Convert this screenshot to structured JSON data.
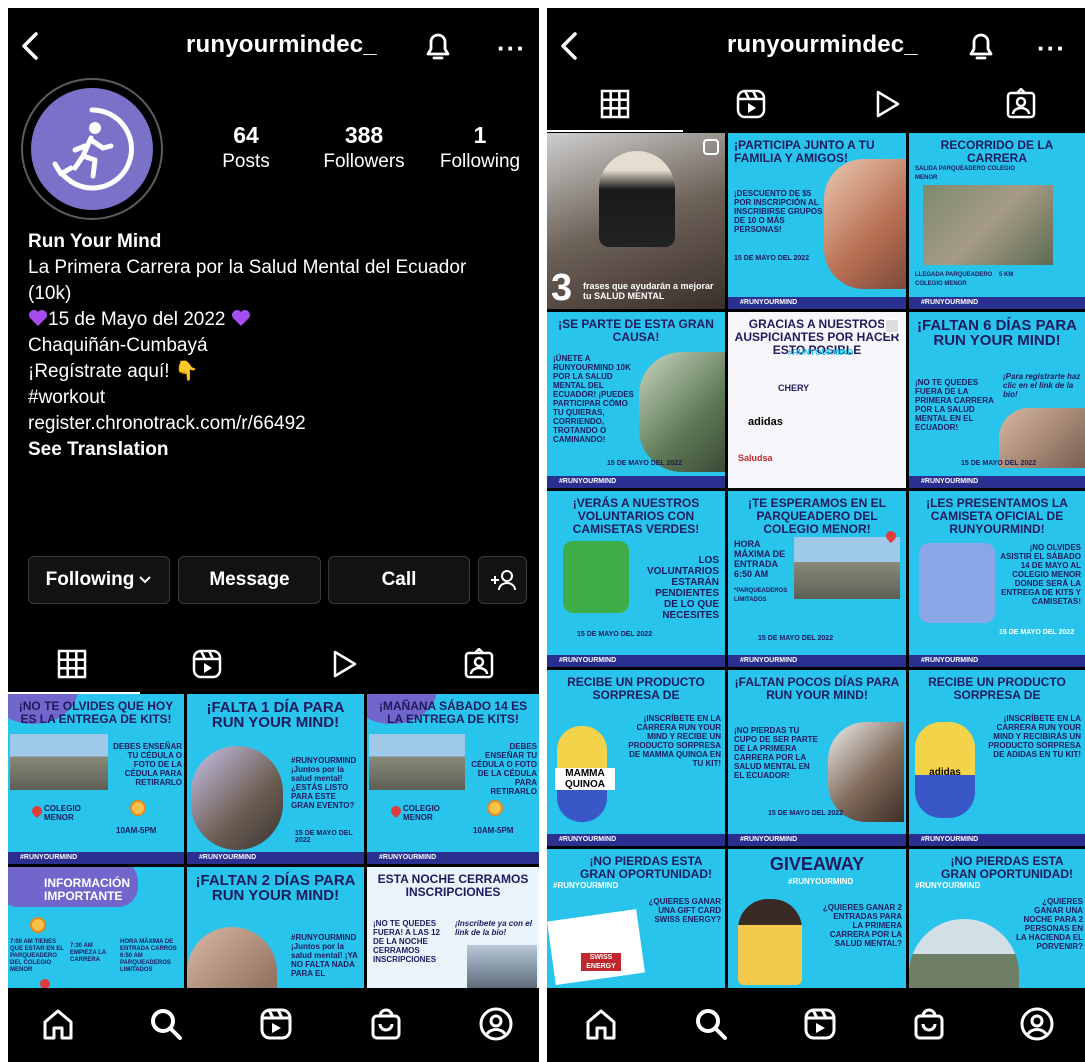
{
  "colors": {
    "background": "#000000",
    "accent_purple": "#7066cc",
    "tile_cyan": "#29c4ec",
    "navy": "#1d1b5e"
  },
  "profile": {
    "username": "runyourmindec_",
    "stats": [
      {
        "num": "64",
        "label": "Posts"
      },
      {
        "num": "388",
        "label": "Followers"
      },
      {
        "num": "1",
        "label": "Following"
      }
    ],
    "name": "Run Your Mind",
    "bio_line1": "La Primera Carrera por la Salud Mental del Ecuador",
    "bio_line2": "(10k)",
    "bio_date": "15 de Mayo del 2022",
    "bio_place": "Chaquiñán-Cumbayá",
    "bio_register": "¡Regístrate aquí! 👇",
    "bio_hashtag": "#workout",
    "bio_link": "register.chronotrack.com/r/66492",
    "see_translation": "See Translation"
  },
  "buttons": {
    "following": "Following",
    "message": "Message",
    "call": "Call"
  },
  "icons": [
    "back-icon",
    "bell-icon",
    "more-icon",
    "grid-icon",
    "reels-icon",
    "play-icon",
    "tagged-icon",
    "home-icon",
    "search-icon",
    "reels-nav-icon",
    "shop-icon",
    "profile-icon",
    "add-person-icon"
  ],
  "left_posts": [
    {
      "head": "¡NO TE OLVIDES QUE HOY ES LA ENTREGA DE KITS!",
      "body": "DEBES ENSEÑAR TU CÉDULA O FOTO DE LA CÉDULA PARA RETIRARLO",
      "place": "COLEGIO MENOR",
      "time": "10AM-5PM",
      "foot": "#RUNYOURMIND"
    },
    {
      "head": "¡FALTA 1 DÍA PARA RUN YOUR MIND!",
      "body": "#RUNYOURMIND ¡Juntos por la salud mental! ¿ESTÁS LISTO PARA ESTE GRAN EVENTO?",
      "date": "15 DE MAYO DEL 2022",
      "foot": "#RUNYOURMIND"
    },
    {
      "head": "¡MAÑANA SÁBADO 14 ES LA ENTREGA DE KITS!",
      "body": "DEBES ENSEÑAR TU CÉDULA O FOTO DE LA CÉDULA PARA RETIRARLO",
      "place": "COLEGIO MENOR",
      "time": "10AM-5PM",
      "foot": "#RUNYOURMIND"
    },
    {
      "head": "INFORMACIÓN IMPORTANTE",
      "body": "7:00 AM TIENES QUE ESTAR EN EL PARQUEADERO DEL COLEGIO MENOR",
      "body2": "7:30 AM EMPIEZA LA CARRERA",
      "body3": "HORA MÁXIMA DE ENTRADA CARROS 6:50 AM PARQUEADEROS LIMITADOS"
    },
    {
      "head": "¡FALTAN 2 DÍAS PARA RUN YOUR MIND!",
      "body": "#RUNYOURMIND ¡Juntos por la salud mental! ¡YA NO FALTA NADA PARA EL"
    },
    {
      "head": "ESTA NOCHE CERRAMOS INSCRIPCIONES",
      "body": "¡NO TE QUEDES FUERA! A LAS 12 DE LA NOCHE CERRAMOS INSCRIPCIONES",
      "body2": "¡Inscríbete ya con el link de la bio!"
    }
  ],
  "right_posts": [
    {
      "head": "",
      "body": "frases que ayudarán a mejorar tu SALUD MENTAL",
      "num": "3"
    },
    {
      "head": "¡PARTICIPA JUNTO A TU FAMILIA Y AMIGOS!",
      "body": "¡DESCUENTO DE $5 POR INSCRIPCIÓN AL INSCRIBIRSE GRUPOS DE 10 O MÁS PERSONAS!",
      "date": "15 DE MAYO DEL 2022",
      "foot": "#RUNYOURMIND"
    },
    {
      "head": "RECORRIDO DE LA CARRERA",
      "body": "SALIDA PARQUEADERO COLEGIO MENOR",
      "body2": "LLEGADA PARQUEADERO COLEGIO MENOR",
      "km": "5 KM",
      "foot": "#RUNYOURMIND"
    },
    {
      "head": "¡SE PARTE DE ESTA GRAN CAUSA!",
      "body": "¡ÚNETE A RUNYOURMIND 10K POR LA SALUD MENTAL DEL ECUADOR! ¡PUEDES PARTICIPAR CÓMO TU QUIERAS, CORRIENDO, TROTANDO O CAMINANDO!",
      "date": "15 DE MAYO DEL 2022",
      "foot": "#RUNYOURMIND"
    },
    {
      "head": "GRACIAS A NUESTROS AUSPICIANTES POR HACER ESTO POSIBLE",
      "sub": "#RUNYOURMIND",
      "logos": [
        "CHERY",
        "adidas",
        "Saludsa"
      ]
    },
    {
      "head": "¡FALTAN 6 DÍAS PARA RUN YOUR MIND!",
      "body": "¡NO TE QUEDES FUERA DE LA PRIMERA CARRERA POR LA SALUD MENTAL EN EL ECUADOR!",
      "body2": "¡Para registrarte haz clic en el link de la bio!",
      "date": "15 DE MAYO DEL 2022",
      "foot": "#RUNYOURMIND"
    },
    {
      "head": "¡VERÁS A NUESTROS VOLUNTARIOS CON CAMISETAS VERDES!",
      "body": "LOS VOLUNTARIOS ESTARÁN PENDIENTES DE LO QUE NECESITES",
      "date": "15 DE MAYO DEL 2022",
      "foot": "#RUNYOURMIND"
    },
    {
      "head": "¡TE ESPERAMOS EN EL PARQUEADERO DEL COLEGIO MENOR!",
      "body": "HORA MÁXIMA DE ENTRADA 6:50 AM",
      "body2": "*PARQUEADEROS LIMITADOS",
      "date": "15 DE MAYO DEL 2022",
      "foot": "#RUNYOURMIND"
    },
    {
      "head": "¡LES PRESENTAMOS LA CAMISETA OFICIAL DE RUNYOURMIND!",
      "body": "¡NO OLVIDES ASISTIR EL SÁBADO 14 DE MAYO AL COLEGIO MENOR DONDE SERÁ LA ENTREGA DE KITS Y CAMISETAS!",
      "date": "15 DE MAYO DEL 2022",
      "foot": "#RUNYOURMIND"
    },
    {
      "head": "RECIBE UN PRODUCTO SORPRESA DE",
      "body": "¡INSCRÍBETE EN LA CARRERA RUN YOUR MIND Y RECIBE UN PRODUCTO SORPRESA DE MAMMA QUINOA EN TU KIT!",
      "brand": "MAMMA QUINOA",
      "foot": "#RUNYOURMIND"
    },
    {
      "head": "¡FALTAN POCOS DÍAS PARA RUN YOUR MIND!",
      "body": "¡NO PIERDAS TU CUPO DE SER PARTE DE LA PRIMERA CARRERA POR LA SALUD MENTAL EN EL ECUADOR!",
      "date": "15 DE MAYO DEL 2022",
      "foot": "#RUNYOURMIND"
    },
    {
      "head": "RECIBE UN PRODUCTO SORPRESA DE",
      "body": "¡INSCRÍBETE EN LA CARRERA RUN YOUR MIND Y RECIBIRÁS UN PRODUCTO SORPRESA DE ADIDAS EN TU KIT!",
      "brand": "adidas",
      "foot": "#RUNYOURMIND"
    },
    {
      "head": "¡NO PIERDAS ESTA GRAN OPORTUNIDAD!",
      "sub": "#RUNYOURMIND",
      "body": "¿QUIERES GANAR UNA GIFT CARD SWISS ENERGY?",
      "brand": "SWISS ENERGY"
    },
    {
      "head": "GIVEAWAY",
      "sub": "#RUNYOURMIND",
      "body": "¿QUIERES GANAR 2 ENTRADAS PARA LA PRIMERA CARRERA POR LA SALUD MENTAL?"
    },
    {
      "head": "¡NO PIERDAS ESTA GRAN OPORTUNIDAD!",
      "sub": "#RUNYOURMIND",
      "body": "¿QUIERES GANAR UNA NOCHE PARA 2 PERSONAS EN LA HACIENDA EL PORVENIR?"
    }
  ]
}
